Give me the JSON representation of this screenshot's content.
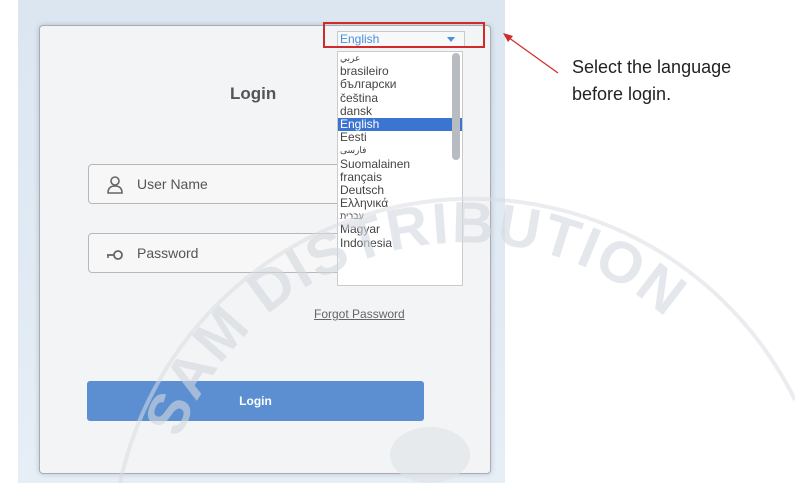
{
  "login": {
    "title": "Login",
    "username_placeholder": "User Name",
    "password_placeholder": "Password",
    "forgot_password": "Forgot Password",
    "login_button": "Login"
  },
  "language": {
    "selected": "English",
    "options": [
      "عربي",
      "brasileiro",
      "български",
      "čeština",
      "dansk",
      "English",
      "Eesti",
      "فارسی",
      "Suomalainen",
      "français",
      "Deutsch",
      "Ελληνικά",
      "עברית",
      "Magyar",
      "Indonesia"
    ]
  },
  "annotation": {
    "line1": "Select the language",
    "line2": "before login."
  },
  "watermark": {
    "text": "SAM DISTRIBUTION"
  },
  "colors": {
    "accent": "#5b8fd2",
    "highlight": "#d12a2a",
    "selected_item": "#3b74d1"
  }
}
